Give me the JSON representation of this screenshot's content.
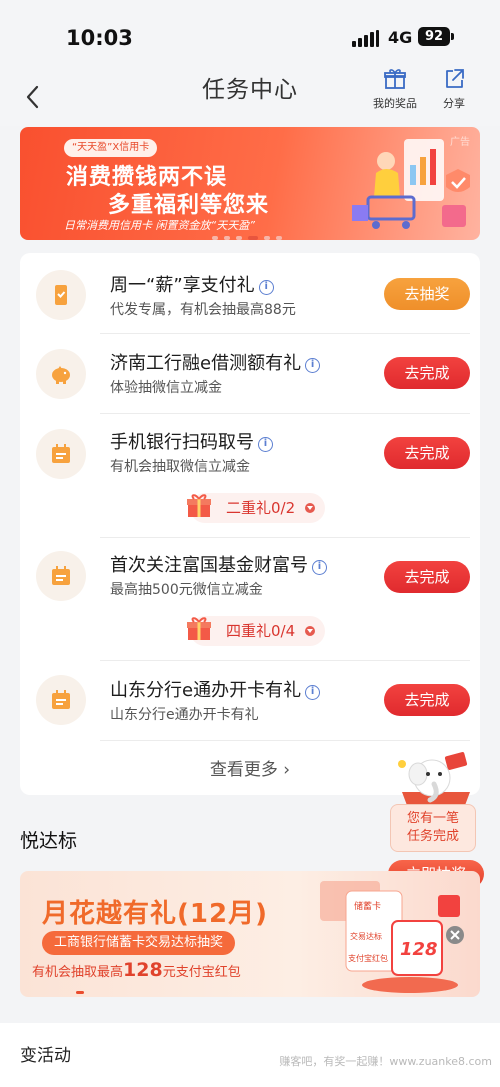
{
  "status_bar": {
    "time": "10:03",
    "network": "4G",
    "battery": "92"
  },
  "nav": {
    "title": "任务中心",
    "my_prizes": "我的奖品",
    "share": "分享"
  },
  "banner": {
    "tag": "“天天盈”X信用卡",
    "ad_label": "广告",
    "line1": "消费攒钱两不误",
    "line2": "多重福利等您来",
    "subtitle": "日常消费用信用卡 闲置资金放“天天盈”"
  },
  "tasks": [
    {
      "title": "周一“薪”享支付礼",
      "desc": "代发专属，有机会抽最高88元",
      "button": "去抽奖",
      "icon": "phone-check-icon"
    },
    {
      "title": "济南工行融e借测额有礼",
      "desc": "体验抽微信立减金",
      "button": "去完成",
      "icon": "piggy-bank-icon"
    },
    {
      "title": "手机银行扫码取号",
      "desc": "有机会抽取微信立减金",
      "button": "去完成",
      "icon": "calendar-icon",
      "sub_reward": "二重礼0/2"
    },
    {
      "title": "首次关注富国基金财富号",
      "desc": "最高抽500元微信立减金",
      "button": "去完成",
      "icon": "calendar-icon",
      "sub_reward": "四重礼0/4"
    },
    {
      "title": "山东分行e通办开卡有礼",
      "desc": "山东分行e通办开卡有礼",
      "button": "去完成",
      "icon": "calendar-icon"
    }
  ],
  "view_more": "查看更多",
  "floating": {
    "text_line1": "您有一笔",
    "text_line2": "任务完成",
    "button": "立即抽奖"
  },
  "section": {
    "title": "悦达标"
  },
  "promo": {
    "title": "月花越有礼(12月)",
    "pill": "工商银行储蓄卡交易达标抽奖",
    "sub_pre": "有机会抽取最高",
    "sub_amount": "128",
    "sub_post": "元支付宝红包",
    "art_label1": "储蓄卡",
    "art_label2": "交易达标",
    "art_label3": "支付宝红包",
    "art_amount": "128"
  },
  "bottom": {
    "heading": "变活动",
    "watermark": "赚客吧，有奖一起赚！www.zuanke8.com"
  },
  "colors": {
    "accent_red": "#e02a2e",
    "accent_orange": "#ef8f2a",
    "info_blue": "#5c7fd1"
  }
}
